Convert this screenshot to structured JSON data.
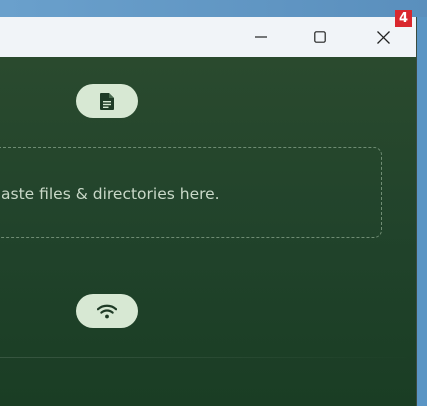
{
  "window": {
    "controls": {
      "minimize_icon": "minimize-icon",
      "maximize_icon": "maximize-icon",
      "close_icon": "close-icon"
    }
  },
  "main": {
    "file_button_icon": "document-icon",
    "dropzone_text": "aste files & directories here.",
    "network_button_icon": "wifi-icon"
  },
  "badge": {
    "count": "4"
  },
  "colors": {
    "accent_pill": "#d7e8d3",
    "background": "#1f3b26",
    "badge": "#d9272e"
  }
}
